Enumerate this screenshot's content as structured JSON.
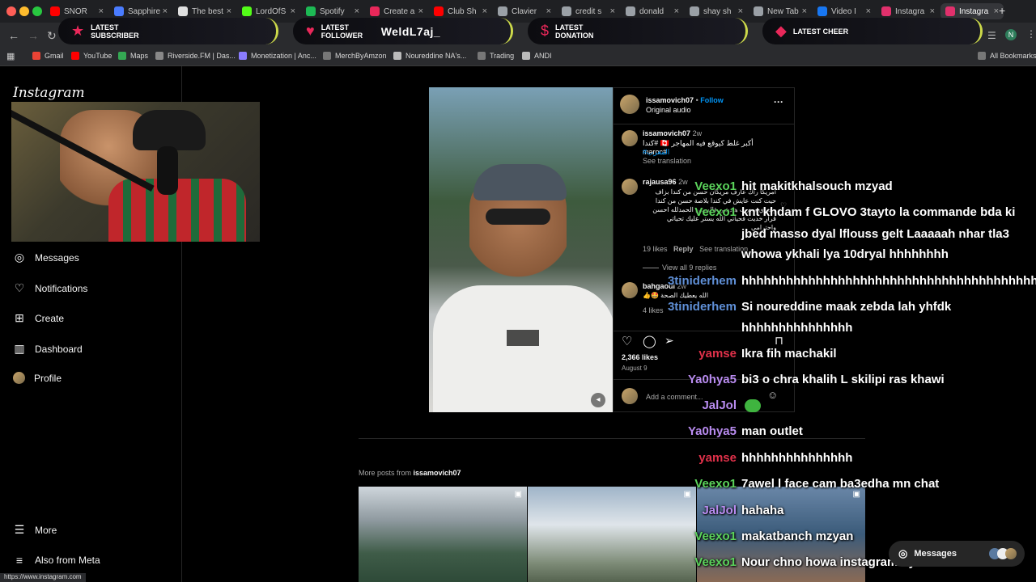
{
  "browser": {
    "tabs": [
      {
        "label": "SNOR",
        "color": "#ff0000"
      },
      {
        "label": "Sapphire",
        "color": "#4a7cff"
      },
      {
        "label": "The best",
        "color": "#e0e0e0"
      },
      {
        "label": "LordOfS",
        "color": "#53fc18"
      },
      {
        "label": "Spotify",
        "color": "#1db954"
      },
      {
        "label": "Create a",
        "color": "#e9285a"
      },
      {
        "label": "Club Sh",
        "color": "#ff0000"
      },
      {
        "label": "Clavier",
        "color": "#9aa0a6"
      },
      {
        "label": "credit s",
        "color": "#9aa0a6"
      },
      {
        "label": "donald",
        "color": "#9aa0a6"
      },
      {
        "label": "shay sh",
        "color": "#9aa0a6"
      },
      {
        "label": "New Tab",
        "color": "#9aa0a6"
      },
      {
        "label": "Video I",
        "color": "#1877f2"
      },
      {
        "label": "Instagra",
        "color": "#e1306c"
      },
      {
        "label": "Instagra",
        "color": "#e1306c",
        "active": true
      }
    ],
    "new_tab": "+",
    "bookmarks": [
      {
        "label": "Gmail",
        "color": "#ea4335"
      },
      {
        "label": "YouTube",
        "color": "#ff0000"
      },
      {
        "label": "Maps",
        "color": "#34a853"
      },
      {
        "label": "Riverside.FM | Das...",
        "color": "#888888"
      },
      {
        "label": "Monetization | Anc...",
        "color": "#8a7cff"
      },
      {
        "label": "MerchByAmzon",
        "color": "#777777"
      },
      {
        "label": "Noureddine NA's...",
        "color": "#bbbbbb"
      },
      {
        "label": "Trading",
        "color": "#777777"
      },
      {
        "label": "ANDI",
        "color": "#bbbbbb"
      }
    ],
    "all_bookmarks": "All Bookmarks",
    "status_url": "https://www.instagram.com"
  },
  "overlay": {
    "alerts": [
      {
        "label": "LATEST SUBSCRIBER",
        "value": ""
      },
      {
        "label": "LATEST FOLLOWER",
        "value": "WeldL7aj_"
      },
      {
        "label": "LATEST DONATION",
        "value": ""
      },
      {
        "label": "LATEST CHEER",
        "value": ""
      }
    ],
    "heart_glyph": "♥",
    "donation_glyph": "$",
    "cheer_glyph": "◆"
  },
  "sidebar": {
    "logo": "Instagram",
    "items": [
      {
        "label": "Messages",
        "icon": "messenger-icon"
      },
      {
        "label": "Notifications",
        "icon": "heart-icon"
      },
      {
        "label": "Create",
        "icon": "plus-icon"
      },
      {
        "label": "Dashboard",
        "icon": "dashboard-icon"
      },
      {
        "label": "Profile",
        "icon": "avatar-icon"
      }
    ],
    "more": "More",
    "also_from_meta": "Also from Meta"
  },
  "post": {
    "author": "issamovich07",
    "follow": "Follow",
    "separator": "•",
    "audio": "Original audio",
    "more_glyph": "···",
    "caption_author": "issamovich07",
    "caption_time": "2w",
    "caption_line1": "أكبر غلط كيوقع فيه المهاجر 🇨🇦 #كندا #maroc",
    "caption_line2": "#المغرب",
    "see_translation": "See translation",
    "comment1_user": "rajausa96",
    "comment1_time": "2w",
    "comment1_text": "أمريكا راك عارف مريكان حسن من كندا بزاف حيت كنت عايش في كندا بلاصة حسن من كندا وعندي مجرب هادشي فالسنين الحمدلله احسن قرار خديت فحياتي الله يستر عليك تحياتي واحترامي",
    "comment1_likes": "19 likes",
    "reply": "Reply",
    "see_translation2": "See translation",
    "view_replies": "View all 9 replies",
    "comment2_user": "bahgaoui",
    "comment2_time": "2w",
    "comment2_text": "الله يعطيك الصحة 🤩👍",
    "comment2_likes": "4 likes",
    "likes": "2,366 likes",
    "date": "August 9",
    "add_comment": "Add a comment..."
  },
  "more_posts": {
    "prefix": "More posts from ",
    "author": "issamovich07"
  },
  "chat": [
    {
      "user": "Veexo1",
      "color": "#5bd35b",
      "text": "hit makitkhalsouch mzyad"
    },
    {
      "user": "Veexo1",
      "color": "#5bd35b",
      "text": "knt khdam f GLOVO 3tayto la commande bda ki"
    },
    {
      "user": "",
      "color": "#5bd35b",
      "text": "jbed masso dyal lflouss gelt Laaaaah nhar tla3"
    },
    {
      "user": "",
      "color": "#5bd35b",
      "text": "whowa ykhali lya 10dryal hhhhhhhh"
    },
    {
      "user": "3tiniderhem",
      "color": "#5f8fd6",
      "text": "hhhhhhhhhhhhhhhhhhhhhhhhhhhhhhhhhhhhhhhh"
    },
    {
      "user": "3tiniderhem",
      "color": "#5f8fd6",
      "text": "Si noureddine maak zebda lah yhfdk"
    },
    {
      "user": "",
      "color": "#5f8fd6",
      "text": "hhhhhhhhhhhhhhh"
    },
    {
      "user": "yamse",
      "color": "#e0314a",
      "text": "Ikra fih machakil"
    },
    {
      "user": "Ya0hya5",
      "color": "#b98cf0",
      "text": "bi3 o chra khalih L skilipi ras khawi"
    },
    {
      "user": "JalJol",
      "color": "#b98cf0",
      "text": ""
    },
    {
      "user": "Ya0hya5",
      "color": "#b98cf0",
      "text": "man outlet"
    },
    {
      "user": "yamse",
      "color": "#e0314a",
      "text": "hhhhhhhhhhhhhhh"
    },
    {
      "user": "Veexo1",
      "color": "#5bd35b",
      "text": "7awel l face cam ba3edha mn chat"
    },
    {
      "user": "JalJol",
      "color": "#b98cf0",
      "text": "hahaha"
    },
    {
      "user": "Veexo1",
      "color": "#5bd35b",
      "text": "makatbanch mzyan"
    },
    {
      "user": "Veexo1",
      "color": "#5bd35b",
      "text": "Nour chno howa instagram dyalk"
    }
  ],
  "messages_pill": "Messages"
}
